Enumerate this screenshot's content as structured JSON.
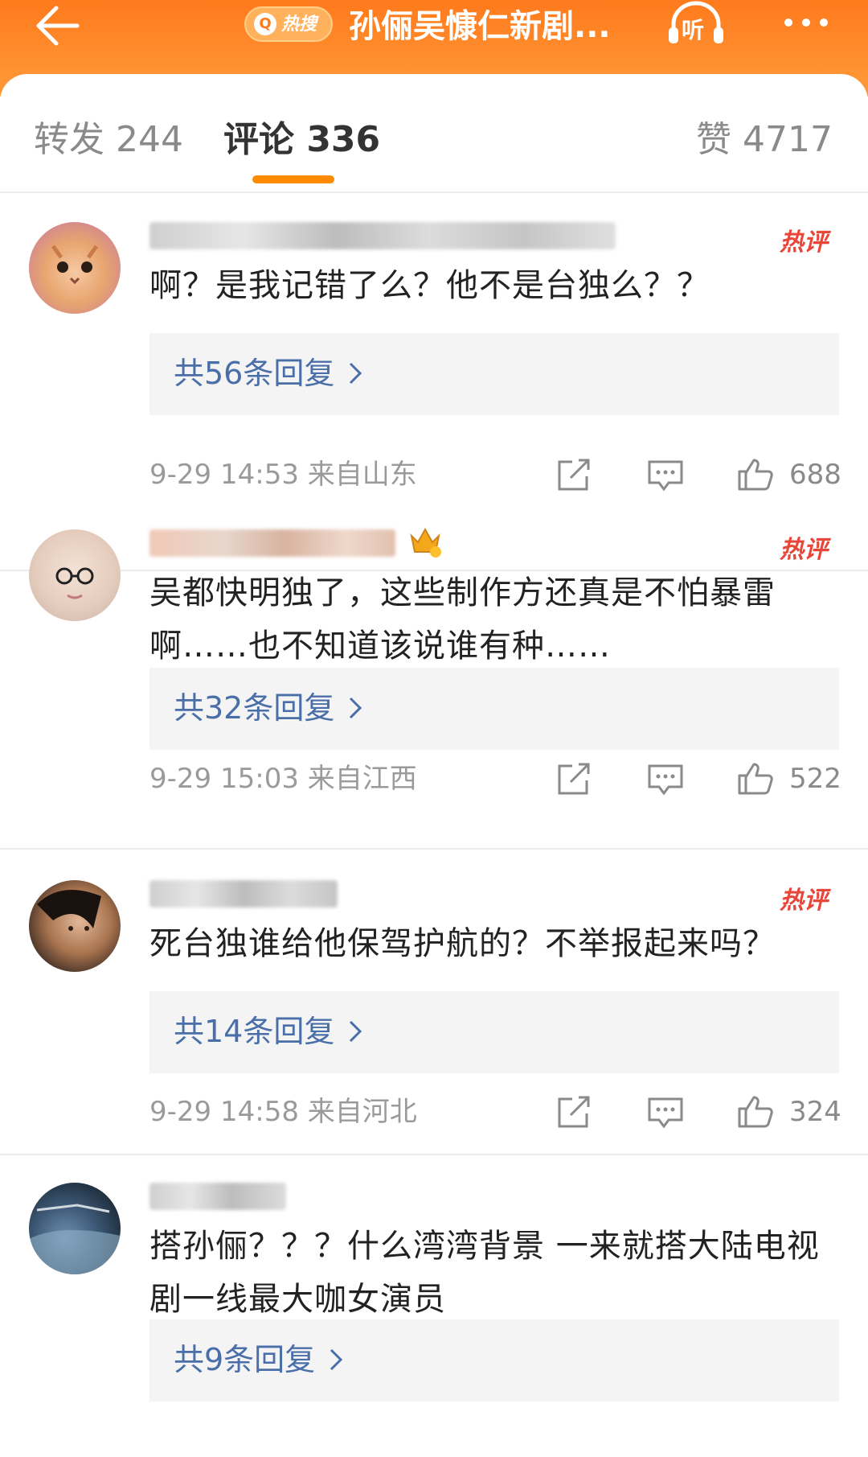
{
  "header": {
    "hot_badge_label": "热搜",
    "title": "孙俪吴慷仁新剧...",
    "listen_label": "听",
    "accent": "#ff8a1e"
  },
  "tabs": {
    "repost": "转发 244",
    "comments": "评论 336",
    "likes": "赞 4717"
  },
  "comments": [
    {
      "hot_tag": "热评",
      "text": "啊？是我记错了么？他不是台独么？？",
      "replies": "共56条回复",
      "time": "9-29 14:53",
      "location": "来自山东",
      "like_count": "688"
    },
    {
      "hot_tag": "热评",
      "text": "吴都快明独了，这些制作方还真是不怕暴雷啊……也不知道该说谁有种……",
      "replies": "共32条回复",
      "time": "9-29 15:03",
      "location": "来自江西",
      "like_count": "522"
    },
    {
      "hot_tag": "热评",
      "text": "死台独谁给他保驾护航的？不举报起来吗？",
      "replies": "共14条回复",
      "time": "9-29 14:58",
      "location": "来自河北",
      "like_count": "324"
    },
    {
      "text": "搭孙俪？？？什么湾湾背景 一来就搭大陆电视剧一线最大咖女演员",
      "replies": "共9条回复"
    }
  ]
}
